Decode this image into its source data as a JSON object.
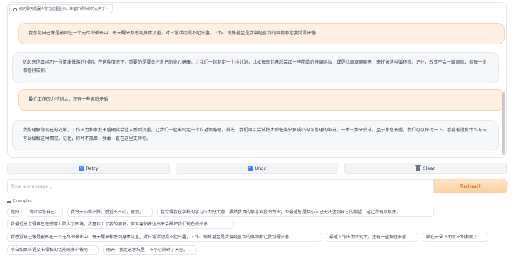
{
  "chatbot": {
    "label": "你的聊天机器人将在这里显示，准备好倾听你的心声了~",
    "messages": [
      {
        "role": "user",
        "text": "我感觉自己像是被困在一个无尽的循环中。每天醒来都感到身体沉重，对日常活动提不起兴趣，工作、锻炼甚至是我曾经喜欢的事物都让我觉得厌倦"
      },
      {
        "role": "assistant",
        "text": "听起来你正经历一段情绪低落的时期。在这种情况下，重要的是要关注自己的身心健康。让我们一起制定一个小计划，比如每天起床后尝试一些简单的伸展运动，或是找朋友聊聊天，来打破这种循环感。记住，改变不会一蹴而就，但每一步都值得庆祝。"
      },
      {
        "role": "user",
        "text": "最近工作压力特别大，还有一些家庭矛盾"
      },
      {
        "role": "assistant",
        "text": "我能理解你现在的处境，工作压力和家庭矛盾确实会让人感到沉重。让我们一起来制定一个应对策略吧。首先，我们可以尝试将大的任务分解成小的可管理的部分，一步一步来完成。至于家庭矛盾，我们可以探讨一下，看看有没有什么方法可以缓解这种情况。记住，你并不孤单，我会一直在这里支持你。"
      }
    ]
  },
  "actions": {
    "retry": "Retry",
    "undo": "Undo",
    "clear": "Clear"
  },
  "input": {
    "placeholder": "Type a message...",
    "value": ""
  },
  "submit": "Submit",
  "examples": {
    "heading": "Examples",
    "items": [
      "你好",
      "请介绍你自己。",
      "我今天心情不好，感觉不开心，很烦。",
      "我觉得我在学校的学习压力好大啊，虽然我真的很喜欢我的专业，但最近总是担心自己无法达到自己的期望，这让我有点焦虑。",
      "我最近总觉得自己在感情上陷入了困境，我喜欢上了我的朋友，但又害怕表达出来会破坏我们现在的关系...",
      "我感觉自己像是被困在一个无尽的循环中。每天醒来都感到身体沉重，对日常活动提不起兴趣，工作、锻炼甚至是我曾经喜欢的事物都让我觉得厌倦",
      "最近工作压力特别大，还有一些家庭矛盾",
      "躺在云朵下面就不怕淋雨了",
      "李白如果告语文书侵权的话能赔多少钱呢",
      "雨天，我走进水坑里，不小心踩碎了天空。"
    ]
  }
}
